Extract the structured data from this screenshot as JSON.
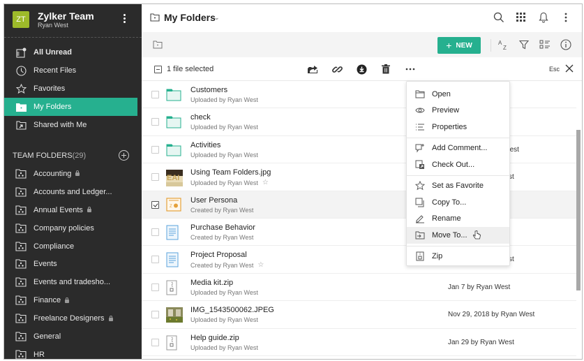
{
  "team": {
    "initials": "ZT",
    "name": "Zylker Team",
    "user": "Ryan West",
    "avatar_color": "#9dba2a"
  },
  "sidebar": {
    "nav": [
      {
        "label": "All Unread",
        "icon": "unread-icon",
        "bold": true
      },
      {
        "label": "Recent Files",
        "icon": "clock-icon"
      },
      {
        "label": "Favorites",
        "icon": "star-icon"
      },
      {
        "label": "My Folders",
        "icon": "folder-icon",
        "active": true
      },
      {
        "label": "Shared with Me",
        "icon": "shared-folder-icon"
      }
    ],
    "team_folders_label": "TEAM FOLDERS",
    "team_folders_count": "(29)",
    "team_folders": [
      {
        "label": "Accounting",
        "locked": true
      },
      {
        "label": "Accounts and Ledger...",
        "locked": false
      },
      {
        "label": "Annual Events",
        "locked": true
      },
      {
        "label": "Company policies",
        "locked": false
      },
      {
        "label": "Compliance",
        "locked": false
      },
      {
        "label": "Events",
        "locked": false
      },
      {
        "label": "Events and tradesho...",
        "locked": false
      },
      {
        "label": "Finance",
        "locked": true
      },
      {
        "label": "Freelance Designers",
        "locked": true
      },
      {
        "label": "General",
        "locked": false
      },
      {
        "label": "HR",
        "locked": false
      }
    ]
  },
  "header": {
    "title": "My Folders"
  },
  "toolbar": {
    "new_label": "NEW",
    "sort_label": "AZ"
  },
  "selection": {
    "text": "1 file selected",
    "esc_label": "Esc"
  },
  "colors": {
    "accent": "#26b08f",
    "sidebar_bg": "#2b2b2b"
  },
  "files": [
    {
      "name": "Customers",
      "meta": "Uploaded by Ryan West",
      "type": "folder",
      "date": "",
      "star": false,
      "selected": false
    },
    {
      "name": "check",
      "meta": "Uploaded by Ryan West",
      "type": "folder",
      "date": "",
      "star": false,
      "selected": false
    },
    {
      "name": "Activities",
      "meta": "Uploaded by Ryan West",
      "type": "folder",
      "date": "n West",
      "star": false,
      "selected": false
    },
    {
      "name": "Using Team Folders.jpg",
      "meta": "Uploaded by Ryan West",
      "type": "image",
      "date": "st",
      "star": true,
      "selected": false
    },
    {
      "name": "User Persona",
      "meta": "Created by Ryan West",
      "type": "presentation",
      "date": "",
      "star": false,
      "selected": true
    },
    {
      "name": "Purchase Behavior",
      "meta": "Created by Ryan West",
      "type": "document",
      "date": "",
      "star": false,
      "selected": false
    },
    {
      "name": "Project Proposal",
      "meta": "Created by Ryan West",
      "type": "document",
      "date": "st",
      "star": true,
      "selected": false
    },
    {
      "name": "Media kit.zip",
      "meta": "Uploaded by Ryan West",
      "type": "zip",
      "date": "Jan 7 by Ryan West",
      "star": false,
      "selected": false
    },
    {
      "name": "IMG_1543500062.JPEG",
      "meta": "Uploaded by Ryan West",
      "type": "photo",
      "date": "Nov 29, 2018 by Ryan West",
      "star": false,
      "selected": false
    },
    {
      "name": "Help guide.zip",
      "meta": "Uploaded by Ryan West",
      "type": "zip",
      "date": "Jan 29 by Ryan West",
      "star": false,
      "selected": false
    }
  ],
  "context_menu": {
    "groups": [
      [
        {
          "label": "Open",
          "icon": "folder-open-icon"
        },
        {
          "label": "Preview",
          "icon": "eye-icon"
        },
        {
          "label": "Properties",
          "icon": "list-icon"
        }
      ],
      [
        {
          "label": "Add Comment...",
          "icon": "comment-icon"
        },
        {
          "label": "Check Out...",
          "icon": "checkout-icon"
        }
      ],
      [
        {
          "label": "Set as Favorite",
          "icon": "star-icon"
        },
        {
          "label": "Copy To...",
          "icon": "copy-icon"
        },
        {
          "label": "Rename",
          "icon": "pencil-icon"
        },
        {
          "label": "Move To...",
          "icon": "move-icon",
          "hover": true
        }
      ],
      [
        {
          "label": "Zip",
          "icon": "zip-icon"
        }
      ]
    ]
  }
}
